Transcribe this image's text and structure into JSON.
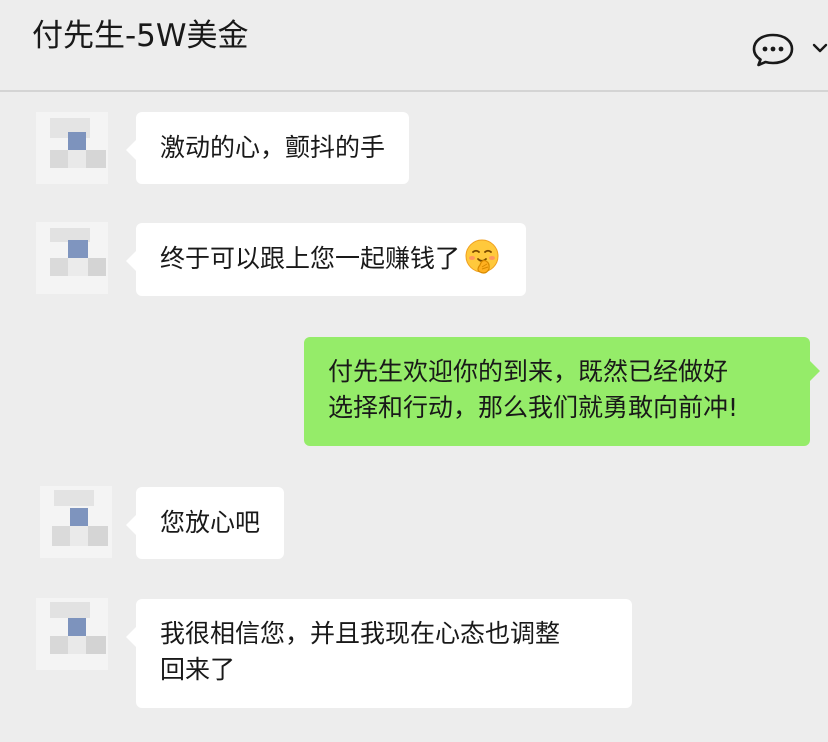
{
  "header": {
    "title": "付先生-5W美金"
  },
  "messages": [
    {
      "side": "left",
      "text": "激动的心，颤抖的手"
    },
    {
      "side": "left",
      "text": "终于可以跟上您一起赚钱了",
      "emoji": "hugging-face-emoji"
    },
    {
      "side": "right",
      "line1": "付先生欢迎你的到来，既然已经做好",
      "line2": "选择和行动，那么我们就勇敢向前冲!"
    },
    {
      "side": "left",
      "text": "您放心吧"
    },
    {
      "side": "left",
      "line1": "我很相信您，并且我现在心态也调整",
      "line2": "回来了"
    }
  ],
  "colors": {
    "background": "#ededed",
    "bubble_in": "#ffffff",
    "bubble_out": "#95ec69"
  }
}
